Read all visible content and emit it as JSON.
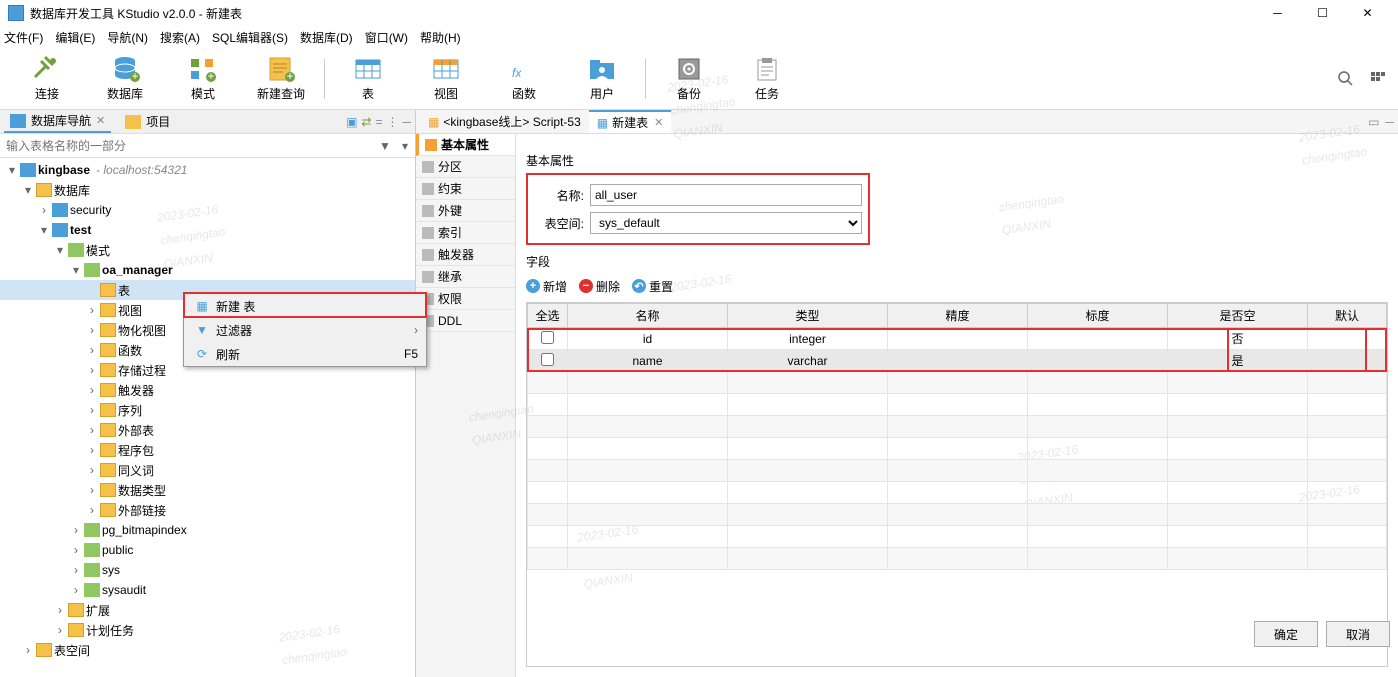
{
  "window": {
    "title": "数据库开发工具 KStudio v2.0.0 - 新建表"
  },
  "menubar": [
    "文件(F)",
    "编辑(E)",
    "导航(N)",
    "搜索(A)",
    "SQL编辑器(S)",
    "数据库(D)",
    "窗口(W)",
    "帮助(H)"
  ],
  "toolbar": [
    "连接",
    "数据库",
    "模式",
    "新建查询",
    "表",
    "视图",
    "函数",
    "用户",
    "备份",
    "任务"
  ],
  "nav": {
    "tab1": "数据库导航",
    "tab2": "项目",
    "filter_placeholder": "输入表格名称的一部分"
  },
  "tree": {
    "root": "kingbase",
    "host": "- localhost:54321",
    "n1": "数据库",
    "n2": "security",
    "n3": "test",
    "n4": "模式",
    "n5": "oa_manager",
    "n6": "表",
    "n7": "视图",
    "n8": "物化视图",
    "n9": "函数",
    "n10": "存储过程",
    "n11": "触发器",
    "n12": "序列",
    "n13": "外部表",
    "n14": "程序包",
    "n15": "同义词",
    "n16": "数据类型",
    "n17": "外部链接",
    "n18": "pg_bitmapindex",
    "n19": "public",
    "n20": "sys",
    "n21": "sysaudit",
    "n22": "扩展",
    "n23": "计划任务",
    "n24": "表空间"
  },
  "context_menu": {
    "new_table": "新建 表",
    "filter": "过滤器",
    "refresh": "刷新",
    "refresh_key": "F5"
  },
  "editor_tabs": {
    "t1": "<kingbase线上> Script-53",
    "t2": "新建表"
  },
  "prop_tabs": [
    "基本属性",
    "分区",
    "约束",
    "外键",
    "索引",
    "触发器",
    "继承",
    "权限",
    "DDL"
  ],
  "form": {
    "section1": "基本属性",
    "name_label": "名称:",
    "name_value": "all_user",
    "ts_label": "表空间:",
    "ts_value": "sys_default",
    "section2": "字段",
    "add": "新增",
    "del": "删除",
    "reset": "重置"
  },
  "grid": {
    "headers": [
      "全选",
      "名称",
      "类型",
      "精度",
      "标度",
      "是否空",
      "默认"
    ],
    "rows": [
      {
        "name": "id",
        "type": "integer",
        "null": "否"
      },
      {
        "name": "name",
        "type": "varchar",
        "null": "是"
      }
    ]
  },
  "buttons": {
    "ok": "确定",
    "cancel": "取消"
  },
  "watermark": {
    "l1": "chenqingtao",
    "l2": "QIANXIN",
    "date": "2023-02-16"
  }
}
